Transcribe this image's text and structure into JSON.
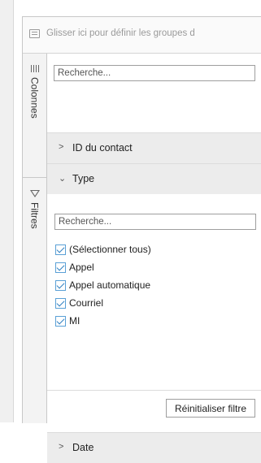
{
  "group_bar": {
    "placeholder": "Glisser ici pour définir les groupes d"
  },
  "side_tabs": [
    {
      "label": "Colonnes",
      "icon": "columns-icon"
    },
    {
      "label": "Filtres",
      "icon": "filter-icon"
    }
  ],
  "columns_search": {
    "placeholder": "Recherche..."
  },
  "sections": {
    "id_contact": {
      "label": "ID du contact",
      "state": "collapsed"
    },
    "type": {
      "label": "Type",
      "state": "expanded"
    },
    "date": {
      "label": "Date",
      "state": "collapsed"
    }
  },
  "type_filter": {
    "search_placeholder": "Recherche...",
    "options": [
      {
        "label": "(Sélectionner tous)",
        "checked": true
      },
      {
        "label": "Appel",
        "checked": true
      },
      {
        "label": "Appel automatique",
        "checked": true
      },
      {
        "label": "Courriel",
        "checked": true
      },
      {
        "label": "MI",
        "checked": true
      }
    ],
    "reset_label": "Réinitialiser filtre"
  },
  "colors": {
    "accent": "#2f7fc1",
    "section_bg": "#ececec"
  }
}
